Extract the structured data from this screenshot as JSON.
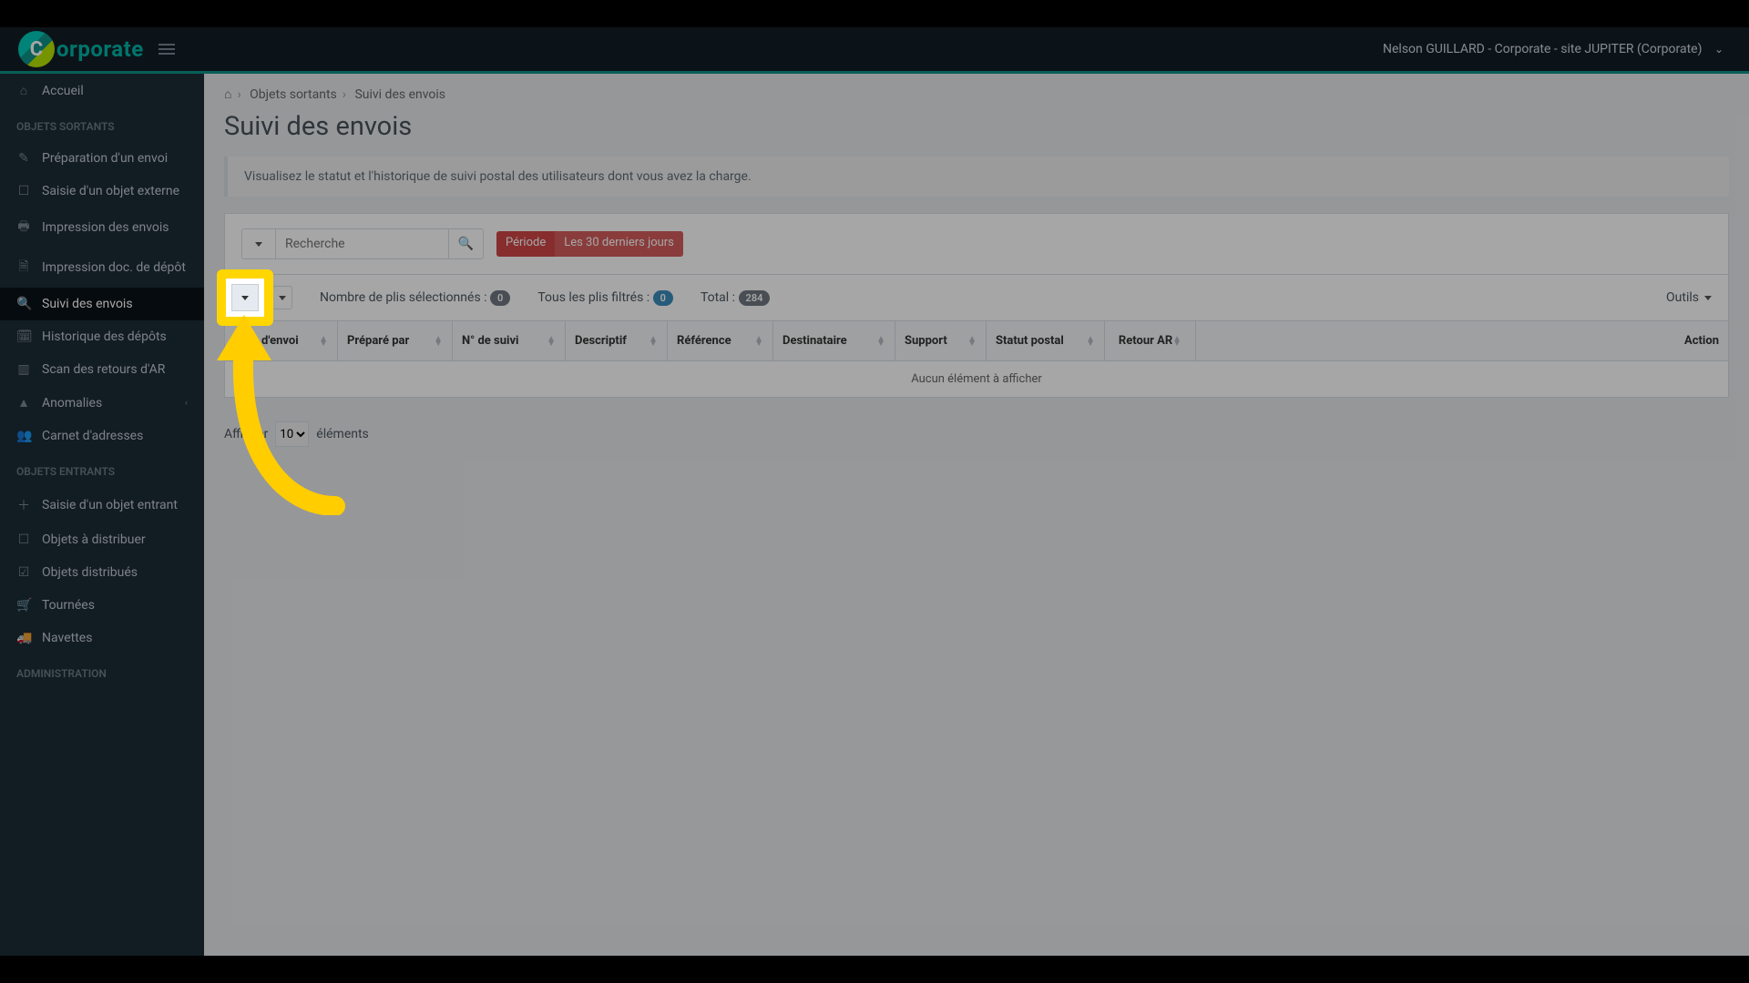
{
  "brand": {
    "word": "orporate"
  },
  "user": {
    "name": "Nelson GUILLARD",
    "site": "Corporate - site JUPITER (Corporate)"
  },
  "breadcrumb": {
    "a": "Objets sortants",
    "b": "Suivi des envois"
  },
  "page_title": "Suivi des envois",
  "hint": "Visualisez le statut et l'historique de suivi postal des utilisateurs dont vous avez la charge.",
  "search": {
    "placeholder": "Recherche"
  },
  "period": {
    "label": "Période",
    "value": "Les 30 derniers jours"
  },
  "counters": {
    "selected_label": "Nombre de plis sélectionnés :",
    "selected": "0",
    "filtered_label": "Tous les plis filtrés :",
    "filtered": "0",
    "total_label": "Total :",
    "total": "284"
  },
  "tools_label": "Outils",
  "cols": {
    "date": "Date d'envoi",
    "prep": "Préparé par",
    "suivi": "N° de suivi",
    "desc": "Descriptif",
    "ref": "Référence",
    "dest": "Destinataire",
    "supp": "Support",
    "statut": "Statut postal",
    "retour": "Retour AR",
    "action": "Action"
  },
  "table_empty": "Aucun élément à afficher",
  "pager": {
    "prefix": "Afficher",
    "suffix": "éléments",
    "value": "10"
  },
  "sidebar": {
    "home": "Accueil",
    "s1": "OBJETS SORTANTS",
    "i1": "Préparation d'un envoi",
    "i2": "Saisie d'un objet externe",
    "i3": "Impression des envois",
    "i4": "Impression doc. de dépôt",
    "i5": "Suivi des envois",
    "i6": "Historique des dépôts",
    "i7": "Scan des retours d'AR",
    "i8": "Anomalies",
    "i9": "Carnet d'adresses",
    "s2": "OBJETS ENTRANTS",
    "j1": "Saisie d'un objet entrant",
    "j2": "Objets à distribuer",
    "j3": "Objets distribués",
    "j4": "Tournées",
    "j5": "Navettes",
    "s3": "ADMINISTRATION"
  }
}
